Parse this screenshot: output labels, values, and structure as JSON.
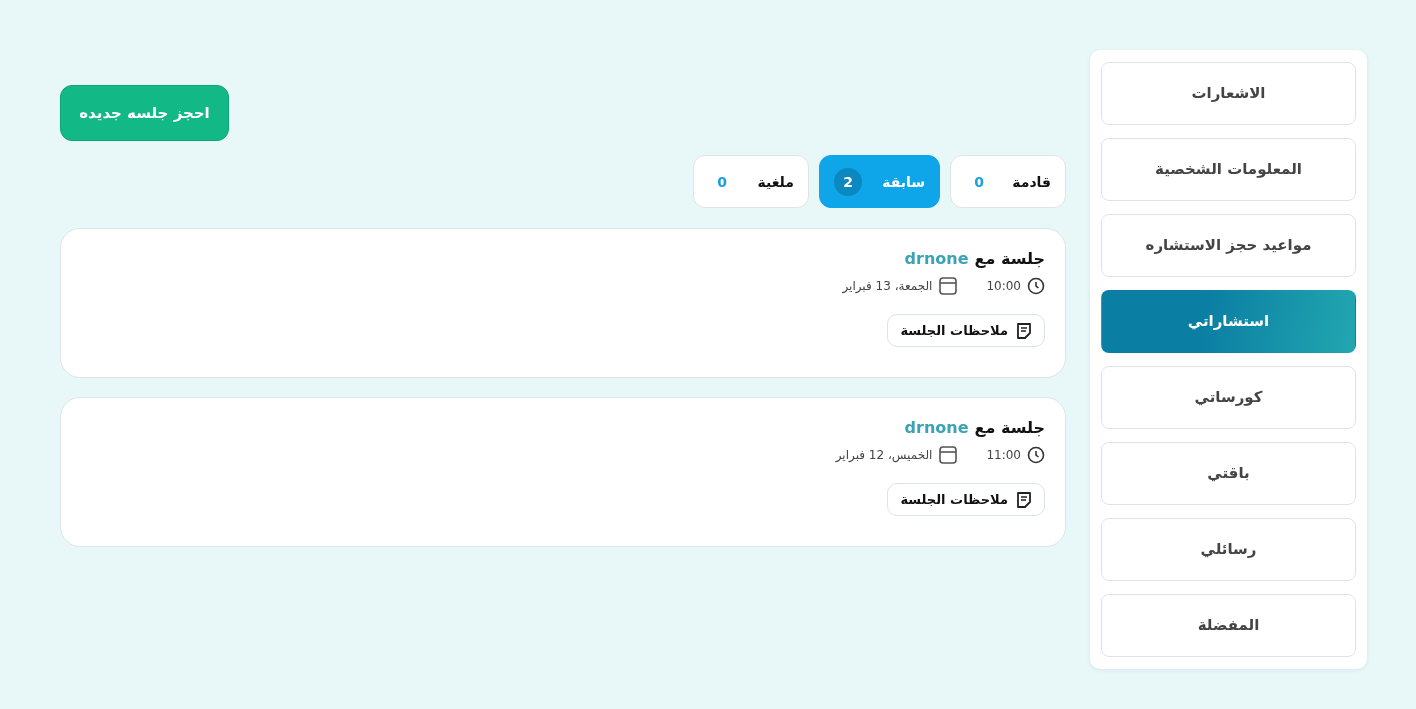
{
  "sidebar": {
    "items": [
      {
        "label": "الاشعارات",
        "selected": false
      },
      {
        "label": "المعلومات الشخصية",
        "selected": false
      },
      {
        "label": "مواعيد حجز الاستشاره",
        "selected": false
      },
      {
        "label": "استشاراتي",
        "selected": true
      },
      {
        "label": "كورساتي",
        "selected": false
      },
      {
        "label": "باقتي",
        "selected": false
      },
      {
        "label": "رسائلي",
        "selected": false
      },
      {
        "label": "المفضلة",
        "selected": false
      }
    ]
  },
  "new_session_button": "احجز جلسه جديده",
  "tabs": [
    {
      "label": "قادمة",
      "count": "0",
      "selected": false
    },
    {
      "label": "سابقة",
      "count": "2",
      "selected": true
    },
    {
      "label": "ملغية",
      "count": "0",
      "selected": false
    }
  ],
  "sessions": [
    {
      "title": "جلسة مع",
      "doctor": "drnone",
      "time": "10:00",
      "date": "الجمعة، 13 فبراير",
      "notes_button": "ملاحظات الجلسة"
    },
    {
      "title": "جلسة مع",
      "doctor": "drnone",
      "time": "11:00",
      "date": "الخميس، 12 فبراير",
      "notes_button": "ملاحظات الجلسة"
    }
  ]
}
